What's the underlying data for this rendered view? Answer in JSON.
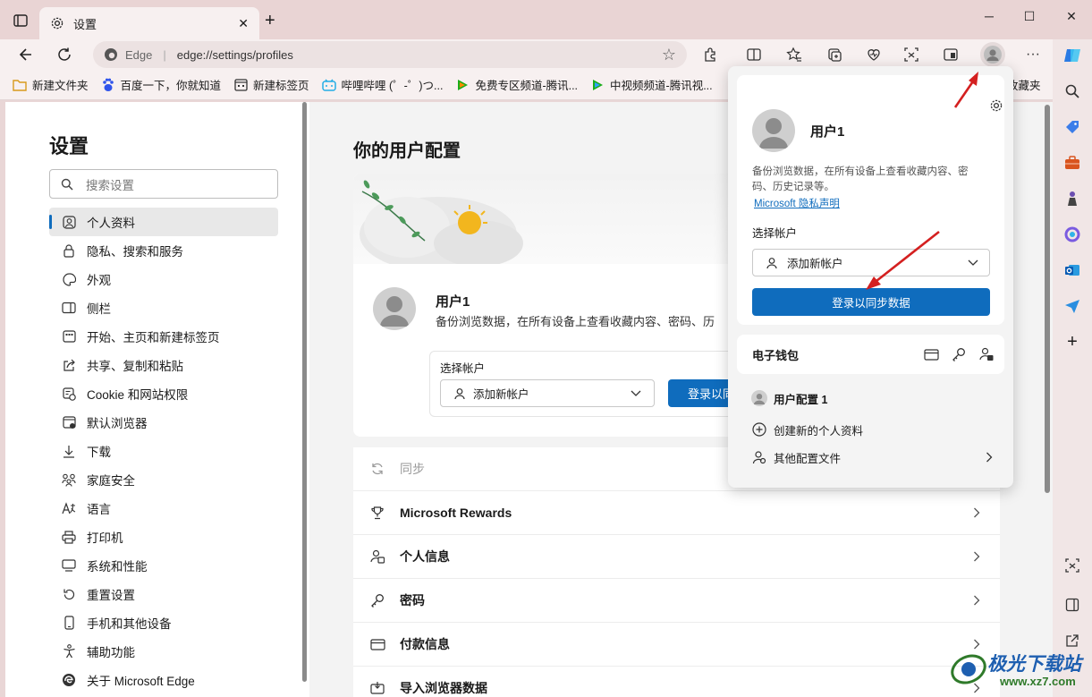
{
  "window": {
    "tab_title": "设置",
    "address_brand": "Edge",
    "address_url": "edge://settings/profiles"
  },
  "bookmarks": [
    {
      "label": "新建文件夹",
      "icon": "folder-icon",
      "color": "#e7a82a"
    },
    {
      "label": "百度一下，你就知道",
      "icon": "baidu-icon",
      "color": "#2f54eb"
    },
    {
      "label": "新建标签页",
      "icon": "newtab-icon",
      "color": "#333333"
    },
    {
      "label": "哔哩哔哩 (゜-゜)つ...",
      "icon": "bilibili-icon",
      "color": "#23ade5"
    },
    {
      "label": "免费专区频道-腾讯...",
      "icon": "tencent-video-icon",
      "color": "#1aad19"
    },
    {
      "label": "中视频频道-腾讯视...",
      "icon": "tencent-video-icon",
      "color": "#1aad19"
    },
    {
      "label": "收藏夹",
      "icon": "favorites-icon",
      "color": "#333333"
    }
  ],
  "settings_nav": {
    "heading": "设置",
    "search_placeholder": "搜索设置",
    "items": [
      {
        "label": "个人资料",
        "icon": "profile-icon",
        "active": true
      },
      {
        "label": "隐私、搜索和服务",
        "icon": "lock-icon"
      },
      {
        "label": "外观",
        "icon": "palette-icon"
      },
      {
        "label": "侧栏",
        "icon": "sidebar-icon"
      },
      {
        "label": "开始、主页和新建标签页",
        "icon": "home-icon"
      },
      {
        "label": "共享、复制和粘贴",
        "icon": "share-icon"
      },
      {
        "label": "Cookie 和网站权限",
        "icon": "cookie-icon"
      },
      {
        "label": "默认浏览器",
        "icon": "browser-icon"
      },
      {
        "label": "下载",
        "icon": "download-icon"
      },
      {
        "label": "家庭安全",
        "icon": "family-icon"
      },
      {
        "label": "语言",
        "icon": "language-icon"
      },
      {
        "label": "打印机",
        "icon": "printer-icon"
      },
      {
        "label": "系统和性能",
        "icon": "system-icon"
      },
      {
        "label": "重置设置",
        "icon": "reset-icon"
      },
      {
        "label": "手机和其他设备",
        "icon": "phone-icon"
      },
      {
        "label": "辅助功能",
        "icon": "accessibility-icon"
      },
      {
        "label": "关于 Microsoft Edge",
        "icon": "edge-icon"
      }
    ]
  },
  "main": {
    "title": "你的用户配置",
    "profile": {
      "name": "用户1",
      "description": "备份浏览数据，在所有设备上查看收藏内容、密码、历"
    },
    "select_account_label": "选择帐户",
    "add_account": "添加新帐户",
    "sign_in_button": "登录以同",
    "rows": [
      {
        "label": "同步",
        "icon": "sync-icon",
        "disabled": true
      },
      {
        "label": "Microsoft Rewards",
        "icon": "trophy-icon"
      },
      {
        "label": "个人信息",
        "icon": "person-card-icon"
      },
      {
        "label": "密码",
        "icon": "key-icon"
      },
      {
        "label": "付款信息",
        "icon": "credit-card-icon"
      },
      {
        "label": "导入浏览器数据",
        "icon": "import-icon"
      }
    ]
  },
  "flyout": {
    "profile_name": "用户1",
    "description": "备份浏览数据，在所有设备上查看收藏内容、密码、历史记录等。",
    "privacy_link": "Microsoft 隐私声明",
    "select_account_label": "选择帐户",
    "add_account": "添加新帐户",
    "sign_in_button": "登录以同步数据",
    "wallet_label": "电子钱包",
    "profile_entry": "用户配置 1",
    "create_profile": "创建新的个人资料",
    "other_profiles": "其他配置文件"
  },
  "watermark": {
    "title": "极光下载站",
    "url": "www.xz7.com"
  },
  "colors": {
    "accent": "#0f6cbd",
    "annotation_arrow": "#d42020"
  }
}
